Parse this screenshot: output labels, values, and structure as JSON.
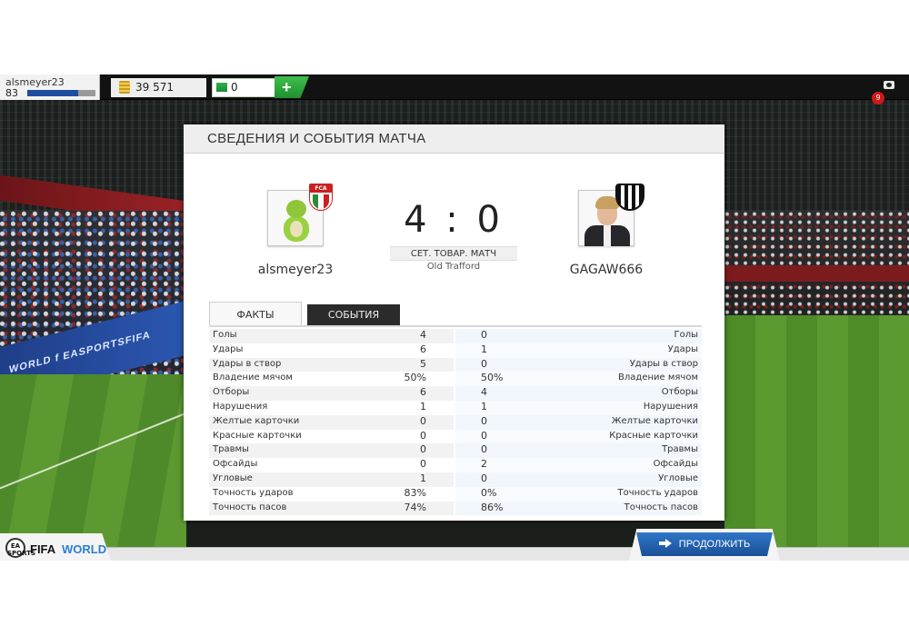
{
  "topbar": {
    "username": "alsmeyer23",
    "level": "83",
    "xp_progress": 0.75,
    "coins": "39 571",
    "points": "0",
    "add_label": "+",
    "notifications": "9"
  },
  "background": {
    "adboard_text": "WORLD  f EASPORTSFIFA"
  },
  "panel": {
    "title": "СВЕДЕНИЯ И СОБЫТИЯ МАТЧА",
    "home": {
      "name": "alsmeyer23",
      "crest_text": "FCA"
    },
    "away": {
      "name": "GAGAW666"
    },
    "score": "4 : 0",
    "match_type": "СЕТ. ТОВАР. МАТЧ",
    "stadium": "Old Trafford",
    "tabs": [
      {
        "label": "ФАКТЫ",
        "active": true
      },
      {
        "label": "СОБЫТИЯ",
        "active": false
      }
    ],
    "stats": [
      {
        "label": "Голы",
        "home": "4",
        "away": "0"
      },
      {
        "label": "Удары",
        "home": "6",
        "away": "1"
      },
      {
        "label": "Удары в створ",
        "home": "5",
        "away": "0"
      },
      {
        "label": "Владение мячом",
        "home": "50%",
        "away": "50%"
      },
      {
        "label": "Отборы",
        "home": "6",
        "away": "4"
      },
      {
        "label": "Нарушения",
        "home": "1",
        "away": "1"
      },
      {
        "label": "Желтые карточки",
        "home": "0",
        "away": "0"
      },
      {
        "label": "Красные карточки",
        "home": "0",
        "away": "0"
      },
      {
        "label": "Травмы",
        "home": "0",
        "away": "0"
      },
      {
        "label": "Офсайды",
        "home": "0",
        "away": "2"
      },
      {
        "label": "Угловые",
        "home": "1",
        "away": "0"
      },
      {
        "label": "Точность ударов",
        "home": "83%",
        "away": "0%"
      },
      {
        "label": "Точность пасов",
        "home": "74%",
        "away": "86%"
      }
    ]
  },
  "footer": {
    "ea_badge": "EA SPORTS",
    "logo_fifa": "FIFA",
    "logo_world": "WORLD",
    "continue_label": "ПРОДОЛЖИТЬ"
  }
}
